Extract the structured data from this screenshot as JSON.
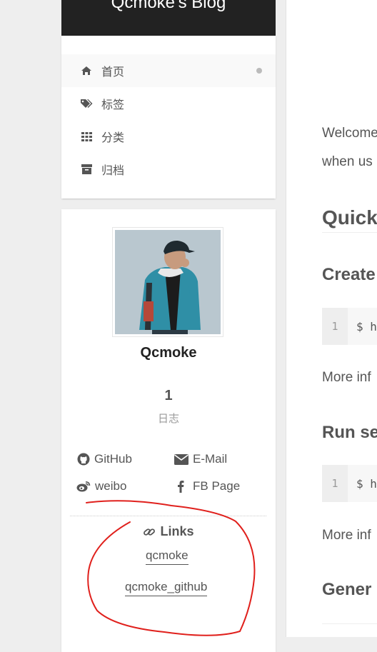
{
  "brand": {
    "title": "Qcmoke's Blog"
  },
  "menu": {
    "items": [
      {
        "label": "首页",
        "icon": "home-icon",
        "active": true
      },
      {
        "label": "标签",
        "icon": "tags-icon"
      },
      {
        "label": "分类",
        "icon": "th-icon"
      },
      {
        "label": "归档",
        "icon": "archive-icon"
      }
    ]
  },
  "sidebar": {
    "author_name": "Qcmoke",
    "stats": {
      "count": "1",
      "label": "日志"
    },
    "social": [
      {
        "label": "GitHub",
        "icon": "github-icon"
      },
      {
        "label": "E-Mail",
        "icon": "envelope-icon"
      },
      {
        "label": "weibo",
        "icon": "weibo-icon"
      },
      {
        "label": "FB Page",
        "icon": "facebook-icon"
      }
    ],
    "links_title": "Links",
    "links": [
      "qcmoke",
      "qcmoke_github"
    ]
  },
  "main": {
    "intro_line1": "Welcome",
    "intro_line2": "when us",
    "quick_heading": "Quick",
    "create_heading": "Create",
    "code1_line": "1",
    "code1_text": "$ h",
    "more1": "More inf",
    "run_heading": "Run se",
    "code2_line": "1",
    "code2_text": "$ h",
    "more2": "More inf",
    "gener_heading": "Gener"
  },
  "colors": {
    "header_bg": "#222222",
    "annotation": "#e0201c"
  }
}
